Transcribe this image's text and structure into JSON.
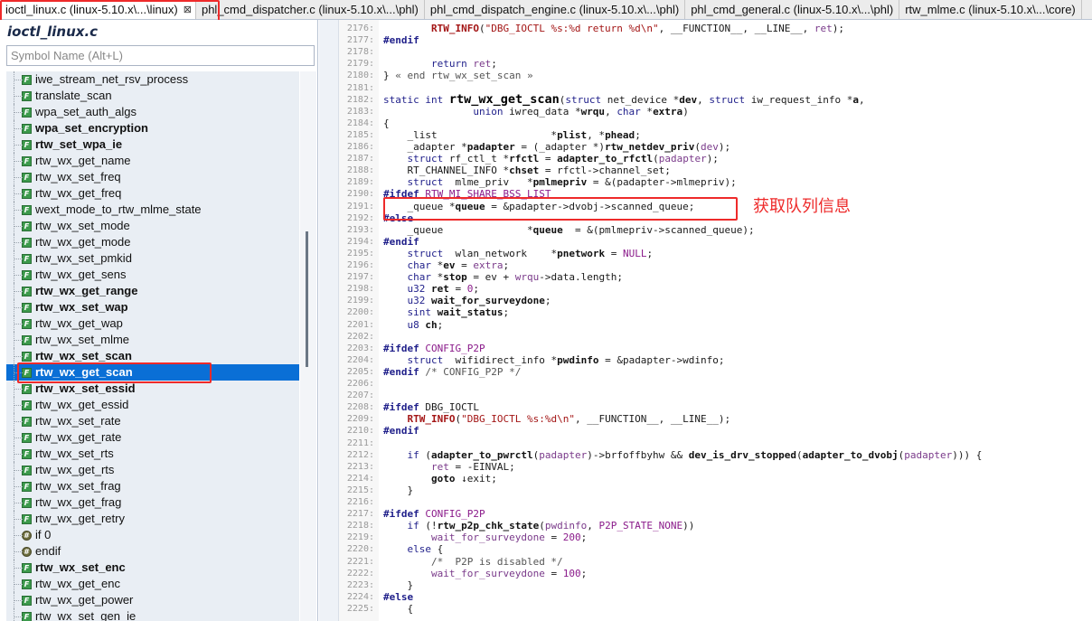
{
  "tabs": [
    {
      "label": "ioctl_linux.c (linux-5.10.x\\...\\linux)",
      "active": true
    },
    {
      "label": "phl_cmd_dispatcher.c (linux-5.10.x\\...\\phl)"
    },
    {
      "label": "phl_cmd_dispatch_engine.c (linux-5.10.x\\...\\phl)"
    },
    {
      "label": "phl_cmd_general.c (linux-5.10.x\\...\\phl)"
    },
    {
      "label": "rtw_mlme.c (linux-5.10.x\\...\\core)"
    }
  ],
  "tab_close_glyph": "⊠",
  "symbol_panel": {
    "title": "ioctl_linux.c",
    "search_placeholder": "Symbol Name (Alt+L)",
    "items": [
      {
        "label": "iwe_stream_net_rsv_process",
        "bold": false
      },
      {
        "label": "translate_scan",
        "bold": false
      },
      {
        "label": "wpa_set_auth_algs",
        "bold": false
      },
      {
        "label": "wpa_set_encryption",
        "bold": true
      },
      {
        "label": "rtw_set_wpa_ie",
        "bold": true
      },
      {
        "label": "rtw_wx_get_name",
        "bold": false
      },
      {
        "label": "rtw_wx_set_freq",
        "bold": false
      },
      {
        "label": "rtw_wx_get_freq",
        "bold": false
      },
      {
        "label": "wext_mode_to_rtw_mlme_state",
        "bold": false
      },
      {
        "label": "rtw_wx_set_mode",
        "bold": false
      },
      {
        "label": "rtw_wx_get_mode",
        "bold": false
      },
      {
        "label": "rtw_wx_set_pmkid",
        "bold": false
      },
      {
        "label": "rtw_wx_get_sens",
        "bold": false
      },
      {
        "label": "rtw_wx_get_range",
        "bold": true
      },
      {
        "label": "rtw_wx_set_wap",
        "bold": true
      },
      {
        "label": "rtw_wx_get_wap",
        "bold": false
      },
      {
        "label": "rtw_wx_set_mlme",
        "bold": false
      },
      {
        "label": "rtw_wx_set_scan",
        "bold": true
      },
      {
        "label": "rtw_wx_get_scan",
        "bold": true,
        "selected": true
      },
      {
        "label": "rtw_wx_set_essid",
        "bold": true
      },
      {
        "label": "rtw_wx_get_essid",
        "bold": false
      },
      {
        "label": "rtw_wx_set_rate",
        "bold": false
      },
      {
        "label": "rtw_wx_get_rate",
        "bold": false
      },
      {
        "label": "rtw_wx_set_rts",
        "bold": false
      },
      {
        "label": "rtw_wx_get_rts",
        "bold": false
      },
      {
        "label": "rtw_wx_set_frag",
        "bold": false
      },
      {
        "label": "rtw_wx_get_frag",
        "bold": false
      },
      {
        "label": "rtw_wx_get_retry",
        "bold": false
      },
      {
        "label": "if 0",
        "bold": false,
        "pp": true
      },
      {
        "label": "endif",
        "bold": false,
        "pp": true
      },
      {
        "label": "rtw_wx_set_enc",
        "bold": true
      },
      {
        "label": "rtw_wx_get_enc",
        "bold": false
      },
      {
        "label": "rtw_wx_get_power",
        "bold": false
      },
      {
        "label": "rtw_wx_set_gen_ie",
        "bold": false
      }
    ]
  },
  "code": {
    "lines": [
      {
        "n": "2176:",
        "h": "        <span class='p'>RTW_INFO</span>(<span class='s'>\"DBG_IOCTL %s:%d return %d\\n\"</span>, __FUNCTION__, __LINE__, <span class='v'>ret</span>);"
      },
      {
        "n": "2177:",
        "h": "<span class='k'>#endif</span>"
      },
      {
        "n": "2178:",
        "h": ""
      },
      {
        "n": "2179:",
        "h": "        <span class='t'>return</span> <span class='v'>ret</span>;"
      },
      {
        "n": "2180:",
        "h": "} <span class='c'>« end rtw_wx_set_scan »</span>"
      },
      {
        "n": "2181:",
        "h": ""
      },
      {
        "n": "2182:",
        "h": "<span class='t'>static int</span> <span class='fn'>rtw_wx_get_scan</span>(<span class='t'>struct</span> net_device *<span class='f'>dev</span>, <span class='t'>struct</span> iw_request_info *<span class='f'>a</span>,"
      },
      {
        "n": "2183:",
        "h": "               <span class='t'>union</span> iwreq_data *<span class='f'>wrqu</span>, <span class='t'>char</span> *<span class='f'>extra</span>)"
      },
      {
        "n": "2184:",
        "h": "{"
      },
      {
        "n": "2185:",
        "h": "    _list                   *<span class='f'>plist</span>, *<span class='f'>phead</span>;"
      },
      {
        "n": "2186:",
        "h": "    _adapter *<span class='f'>padapter</span> = (_adapter *)<span class='f'>rtw_netdev_priv</span>(<span class='v'>dev</span>);"
      },
      {
        "n": "2187:",
        "h": "    <span class='t'>struct</span> rf_ctl_t *<span class='f'>rfctl</span> = <span class='f'>adapter_to_rfctl</span>(<span class='v'>padapter</span>);"
      },
      {
        "n": "2188:",
        "h": "    RT_CHANNEL_INFO *<span class='f'>chset</span> = rfctl->channel_set;"
      },
      {
        "n": "2189:",
        "h": "    <span class='t'>struct</span>  mlme_priv   *<span class='f'>pmlmepriv</span> = &(padapter->mlmepriv);"
      },
      {
        "n": "2190:",
        "h": "<span class='k'>#ifdef</span> <span class='m'>RTW_MI_SHARE_BSS_LIST</span>"
      },
      {
        "n": "2191:",
        "h": "    _queue *<span class='f'>queue</span> = &padapter->dvobj->scanned_queue;"
      },
      {
        "n": "2192:",
        "h": "<span class='k'>#else</span>"
      },
      {
        "n": "2193:",
        "h": "    _queue              *<span class='f'>queue</span>  = &(pmlmepriv->scanned_queue);"
      },
      {
        "n": "2194:",
        "h": "<span class='k'>#endif</span>"
      },
      {
        "n": "2195:",
        "h": "    <span class='t'>struct</span>  wlan_network    *<span class='f'>pnetwork</span> = <span class='m'>NULL</span>;"
      },
      {
        "n": "2196:",
        "h": "    <span class='t'>char</span> *<span class='f'>ev</span> = <span class='v'>extra</span>;"
      },
      {
        "n": "2197:",
        "h": "    <span class='t'>char</span> *<span class='f'>stop</span> = ev + <span class='v'>wrqu</span>->data.length;"
      },
      {
        "n": "2198:",
        "h": "    <span class='t'>u32</span> <span class='f'>ret</span> = <span class='m'>0</span>;"
      },
      {
        "n": "2199:",
        "h": "    <span class='t'>u32</span> <span class='f'>wait_for_surveydone</span>;"
      },
      {
        "n": "2200:",
        "h": "    <span class='t'>sint</span> <span class='f'>wait_status</span>;"
      },
      {
        "n": "2201:",
        "h": "    <span class='t'>u8</span> <span class='f'>ch</span>;"
      },
      {
        "n": "2202:",
        "h": ""
      },
      {
        "n": "2203:",
        "h": "<span class='k'>#ifdef</span> <span class='m'>CONFIG_P2P</span>"
      },
      {
        "n": "2204:",
        "h": "    <span class='t'>struct</span>  wifidirect_info *<span class='f'>pwdinfo</span> = &padapter->wdinfo;"
      },
      {
        "n": "2205:",
        "h": "<span class='k'>#endif</span> <span class='c'>/* CONFIG_P2P */</span>"
      },
      {
        "n": "2206:",
        "h": ""
      },
      {
        "n": "2207:",
        "h": ""
      },
      {
        "n": "2208:",
        "h": "<span class='k'>#ifdef</span> DBG_IOCTL"
      },
      {
        "n": "2209:",
        "h": "    <span class='p'>RTW_INFO</span>(<span class='s'>\"DBG_IOCTL %s:%d\\n\"</span>, __FUNCTION__, __LINE__);"
      },
      {
        "n": "2210:",
        "h": "<span class='k'>#endif</span>"
      },
      {
        "n": "2211:",
        "h": ""
      },
      {
        "n": "2212:",
        "h": "    <span class='t'>if</span> (<span class='f'>adapter_to_pwrctl</span>(<span class='v'>padapter</span>)->brfoffbyhw && <span class='f'>dev_is_drv_stopped</span>(<span class='f'>adapter_to_dvobj</span>(<span class='v'>padapter</span>))) {"
      },
      {
        "n": "2213:",
        "h": "        <span class='v'>ret</span> = -EINVAL;"
      },
      {
        "n": "2214:",
        "h": "        <span class='f'>goto</span> ↓exit;"
      },
      {
        "n": "2215:",
        "h": "    }"
      },
      {
        "n": "2216:",
        "h": ""
      },
      {
        "n": "2217:",
        "h": "<span class='k'>#ifdef</span> <span class='m'>CONFIG_P2P</span>"
      },
      {
        "n": "2218:",
        "h": "    <span class='t'>if</span> (!<span class='f'>rtw_p2p_chk_state</span>(<span class='v'>pwdinfo</span>, <span class='m'>P2P_STATE_NONE</span>))"
      },
      {
        "n": "2219:",
        "h": "        <span class='v'>wait_for_surveydone</span> = <span class='m'>200</span>;"
      },
      {
        "n": "2220:",
        "h": "    <span class='t'>else</span> {"
      },
      {
        "n": "2221:",
        "h": "        <span class='c'>/*  P2P is disabled */</span>"
      },
      {
        "n": "2222:",
        "h": "        <span class='v'>wait_for_surveydone</span> = <span class='m'>100</span>;"
      },
      {
        "n": "2223:",
        "h": "    }"
      },
      {
        "n": "2224:",
        "h": "<span class='k'>#else</span>"
      },
      {
        "n": "2225:",
        "h": "    {"
      }
    ]
  },
  "annotation": "获取队列信息"
}
